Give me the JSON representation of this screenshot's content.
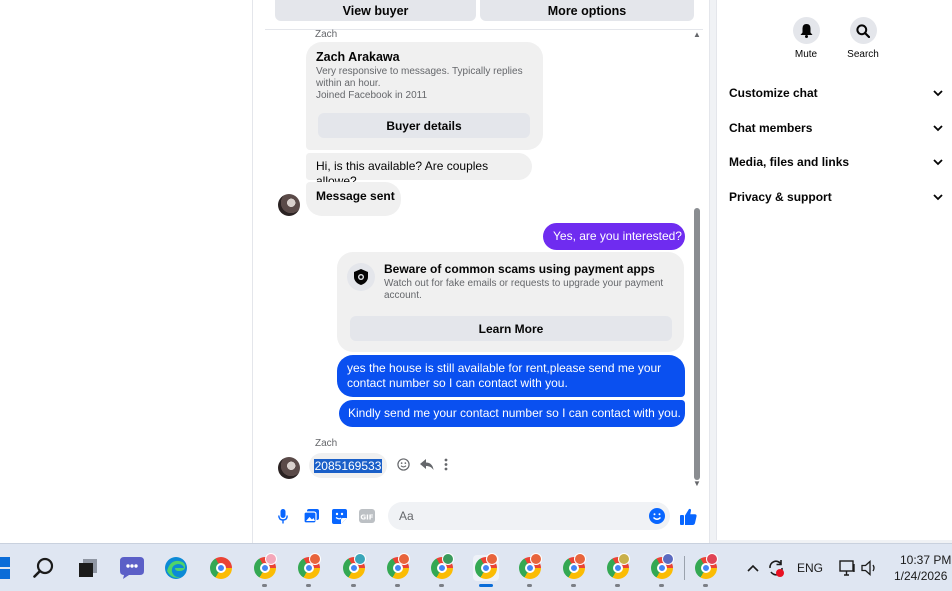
{
  "top_buttons": {
    "view_buyer": "View buyer",
    "more_options": "More options"
  },
  "buyer_card": {
    "sender": "Zach",
    "name": "Zach Arakawa",
    "desc_line1": "Very responsive to messages. Typically replies",
    "desc_line2": "within an hour.",
    "joined": "Joined Facebook in 2011",
    "button": "Buyer details"
  },
  "messages": {
    "incoming_1": "Hi, is this available? Are couples allowe?",
    "incoming_2": "Message sent",
    "outgoing_1": "Yes, are you interested?",
    "outgoing_2_line1": "yes the house is still available for rent,please send me your",
    "outgoing_2_line2": "contact number so I can contact with you.",
    "outgoing_3": "Kindly send me your contact number so I can contact with you.",
    "sender_2": "Zach",
    "phone": "2085169533"
  },
  "scam_warning": {
    "title": "Beware of common scams using payment apps",
    "desc_line1": "Watch out for fake emails or requests to upgrade your payment",
    "desc_line2": "account.",
    "button": "Learn More"
  },
  "composer": {
    "placeholder": "Aa"
  },
  "right_panel": {
    "mute": "Mute",
    "search": "Search",
    "rows": [
      "Customize chat",
      "Chat members",
      "Media, files and links",
      "Privacy & support"
    ]
  },
  "taskbar": {
    "lang": "ENG",
    "time": "10:37 PM",
    "date": "1/24/2026",
    "chrome_badges": [
      "#f4a7b9",
      "#e8643c",
      "#3aa6b9",
      "#e8643c",
      "#3a9a5c",
      "#e8643c",
      "#e8643c",
      "#e8643c",
      "#c9b04a",
      "#5c6bc0",
      "#e04455"
    ]
  },
  "colors": {
    "accent_blue": "#0a50f0",
    "accent_purple": "#6f2cf0",
    "fb_blue": "#0866ff"
  }
}
